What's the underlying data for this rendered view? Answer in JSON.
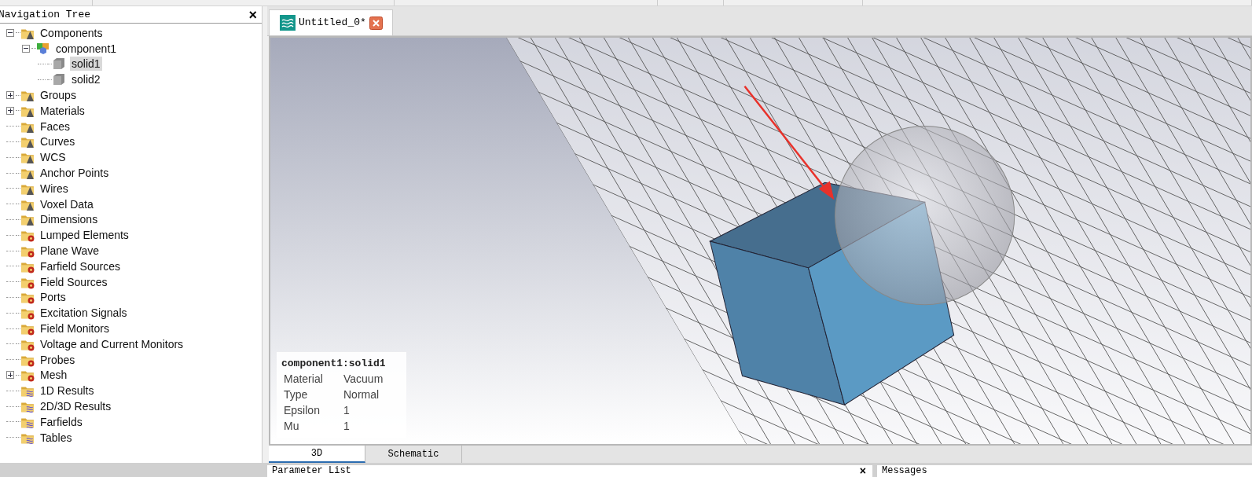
{
  "navigation_tree": {
    "title": "Navigation Tree",
    "close": "×",
    "items": [
      {
        "label": "Components",
        "kind": "folder-cone",
        "expanded": true,
        "selected": false,
        "children": [
          {
            "label": "component1",
            "kind": "component",
            "expanded": true,
            "selected": false,
            "children": [
              {
                "label": "solid1",
                "kind": "solid",
                "selected": true
              },
              {
                "label": "solid2",
                "kind": "solid",
                "selected": false
              }
            ]
          }
        ]
      },
      {
        "label": "Groups",
        "kind": "folder-cone",
        "expanded": false,
        "selected": false
      },
      {
        "label": "Materials",
        "kind": "folder-cone",
        "expanded": false,
        "selected": false
      },
      {
        "label": "Faces",
        "kind": "folder-cone",
        "selected": false
      },
      {
        "label": "Curves",
        "kind": "folder-cone",
        "selected": false
      },
      {
        "label": "WCS",
        "kind": "folder-cone",
        "selected": false
      },
      {
        "label": "Anchor Points",
        "kind": "folder-cone",
        "selected": false
      },
      {
        "label": "Wires",
        "kind": "folder-cone",
        "selected": false
      },
      {
        "label": "Voxel Data",
        "kind": "folder-cone",
        "selected": false
      },
      {
        "label": "Dimensions",
        "kind": "folder-cone",
        "selected": false
      },
      {
        "label": "Lumped Elements",
        "kind": "folder-gear",
        "selected": false
      },
      {
        "label": "Plane Wave",
        "kind": "folder-gear",
        "selected": false
      },
      {
        "label": "Farfield Sources",
        "kind": "folder-gear",
        "selected": false
      },
      {
        "label": "Field Sources",
        "kind": "folder-gear",
        "selected": false
      },
      {
        "label": "Ports",
        "kind": "folder-gear",
        "selected": false
      },
      {
        "label": "Excitation Signals",
        "kind": "folder-gear",
        "selected": false
      },
      {
        "label": "Field Monitors",
        "kind": "folder-gear",
        "selected": false
      },
      {
        "label": "Voltage and Current Monitors",
        "kind": "folder-gear",
        "selected": false
      },
      {
        "label": "Probes",
        "kind": "folder-gear",
        "selected": false
      },
      {
        "label": "Mesh",
        "kind": "folder-gear",
        "expanded": false,
        "selected": false
      },
      {
        "label": "1D Results",
        "kind": "folder-wave",
        "selected": false
      },
      {
        "label": "2D/3D Results",
        "kind": "folder-wave",
        "selected": false
      },
      {
        "label": "Farfields",
        "kind": "folder-wave",
        "selected": false
      },
      {
        "label": "Tables",
        "kind": "folder-wave",
        "selected": false
      }
    ]
  },
  "document_tabs": [
    {
      "label": "Untitled_0*",
      "selected": true
    }
  ],
  "viewport": {
    "info": {
      "title": "component1:solid1",
      "rows": [
        {
          "name": "Material",
          "value": "Vacuum"
        },
        {
          "name": "Type",
          "value": "Normal"
        },
        {
          "name": "Epsilon",
          "value": "1"
        },
        {
          "name": "Mu",
          "value": "1"
        }
      ]
    }
  },
  "view_tabs": [
    {
      "label": "3D",
      "selected": true
    },
    {
      "label": "Schematic",
      "selected": false
    }
  ],
  "bottom_panels": [
    {
      "title": "Parameter List",
      "close": "×"
    },
    {
      "title": "Messages"
    }
  ]
}
